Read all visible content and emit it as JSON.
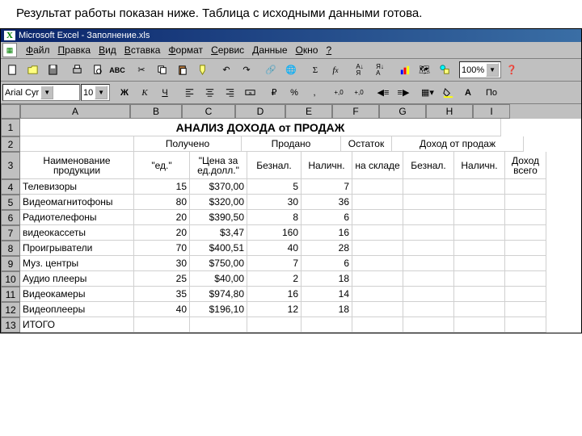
{
  "caption": "Результат работы показан ниже. Таблица с исходными данными готова.",
  "title": "Microsoft Excel - Заполнение.xls",
  "menu": [
    "Файл",
    "Правка",
    "Вид",
    "Вставка",
    "Формат",
    "Сервис",
    "Данные",
    "Окно",
    "?"
  ],
  "zoom": "100%",
  "font": "Arial Cyr",
  "fontsize": "10",
  "fmtBtns": {
    "b": "Ж",
    "i": "К",
    "u": "Ч",
    "pct": "%",
    "comma": ",",
    "inc": "+,0",
    "dec": "+,0"
  },
  "pobtn": "По",
  "cols": [
    "A",
    "B",
    "C",
    "D",
    "E",
    "F",
    "G",
    "H",
    "I"
  ],
  "colW": [
    "cA",
    "cB",
    "cC",
    "cD",
    "cE",
    "cF",
    "cG",
    "cH",
    "cI"
  ],
  "rows": [
    {
      "n": "1",
      "h": "r1",
      "cells": [
        {
          "t": "АНАЛИЗ ДОХОДА от ПРОДАЖ",
          "span": 9,
          "cls": "tac bold",
          "style": "font-size:14px"
        }
      ]
    },
    {
      "n": "2",
      "cells": [
        {
          "t": ""
        },
        {
          "t": "Получено",
          "span": 2,
          "cls": "tac"
        },
        {
          "t": "Продано",
          "span": 2,
          "cls": "tac"
        },
        {
          "t": "Остаток",
          "cls": "tac"
        },
        {
          "t": "Доход от продаж",
          "span": 3,
          "cls": "tac"
        }
      ]
    },
    {
      "n": "3",
      "h": "r3",
      "cells": [
        {
          "t": "Наименование продукции",
          "cls": "tac",
          "wrap": true
        },
        {
          "t": "\"ед.\"",
          "cls": "tac"
        },
        {
          "t": "\"Цена за ед.долл.\"",
          "cls": "tac",
          "wrap": true
        },
        {
          "t": "Безнал.",
          "cls": "tac"
        },
        {
          "t": "Наличн.",
          "cls": "tac"
        },
        {
          "t": "на складе",
          "cls": "tac",
          "wrap": true
        },
        {
          "t": "Безнал.",
          "cls": "tac"
        },
        {
          "t": "Наличн.",
          "cls": "tac"
        },
        {
          "t": "Доход всего",
          "cls": "tac",
          "wrap": true
        }
      ]
    },
    {
      "n": "4",
      "cells": [
        {
          "t": "Телевизоры"
        },
        {
          "t": "15",
          "cls": "tar"
        },
        {
          "t": "$370,00",
          "cls": "tar"
        },
        {
          "t": "5",
          "cls": "tar"
        },
        {
          "t": "7",
          "cls": "tar"
        },
        {
          "t": ""
        },
        {
          "t": ""
        },
        {
          "t": ""
        },
        {
          "t": ""
        }
      ]
    },
    {
      "n": "5",
      "cells": [
        {
          "t": "Видеомагнитофоны"
        },
        {
          "t": "80",
          "cls": "tar"
        },
        {
          "t": "$320,00",
          "cls": "tar"
        },
        {
          "t": "30",
          "cls": "tar"
        },
        {
          "t": "36",
          "cls": "tar"
        },
        {
          "t": ""
        },
        {
          "t": ""
        },
        {
          "t": ""
        },
        {
          "t": ""
        }
      ]
    },
    {
      "n": "6",
      "cells": [
        {
          "t": "Радиотелефоны"
        },
        {
          "t": "20",
          "cls": "tar"
        },
        {
          "t": "$390,50",
          "cls": "tar"
        },
        {
          "t": "8",
          "cls": "tar"
        },
        {
          "t": "6",
          "cls": "tar"
        },
        {
          "t": ""
        },
        {
          "t": ""
        },
        {
          "t": ""
        },
        {
          "t": ""
        }
      ]
    },
    {
      "n": "7",
      "cells": [
        {
          "t": "видеокассеты"
        },
        {
          "t": "20",
          "cls": "tar"
        },
        {
          "t": "$3,47",
          "cls": "tar"
        },
        {
          "t": "160",
          "cls": "tar"
        },
        {
          "t": "16",
          "cls": "tar"
        },
        {
          "t": ""
        },
        {
          "t": ""
        },
        {
          "t": ""
        },
        {
          "t": ""
        }
      ]
    },
    {
      "n": "8",
      "cells": [
        {
          "t": "Проигрыватели"
        },
        {
          "t": "70",
          "cls": "tar"
        },
        {
          "t": "$400,51",
          "cls": "tar"
        },
        {
          "t": "40",
          "cls": "tar"
        },
        {
          "t": "28",
          "cls": "tar"
        },
        {
          "t": ""
        },
        {
          "t": ""
        },
        {
          "t": ""
        },
        {
          "t": ""
        }
      ]
    },
    {
      "n": "9",
      "cells": [
        {
          "t": "Муз. центры"
        },
        {
          "t": "30",
          "cls": "tar"
        },
        {
          "t": "$750,00",
          "cls": "tar"
        },
        {
          "t": "7",
          "cls": "tar"
        },
        {
          "t": "6",
          "cls": "tar"
        },
        {
          "t": ""
        },
        {
          "t": ""
        },
        {
          "t": ""
        },
        {
          "t": ""
        }
      ]
    },
    {
      "n": "10",
      "cells": [
        {
          "t": "Аудио плееры"
        },
        {
          "t": "25",
          "cls": "tar"
        },
        {
          "t": "$40,00",
          "cls": "tar"
        },
        {
          "t": "2",
          "cls": "tar"
        },
        {
          "t": "18",
          "cls": "tar"
        },
        {
          "t": ""
        },
        {
          "t": ""
        },
        {
          "t": ""
        },
        {
          "t": ""
        }
      ]
    },
    {
      "n": "11",
      "cells": [
        {
          "t": "Видеокамеры"
        },
        {
          "t": "35",
          "cls": "tar"
        },
        {
          "t": "$974,80",
          "cls": "tar"
        },
        {
          "t": "16",
          "cls": "tar"
        },
        {
          "t": "14",
          "cls": "tar"
        },
        {
          "t": ""
        },
        {
          "t": ""
        },
        {
          "t": ""
        },
        {
          "t": ""
        }
      ]
    },
    {
      "n": "12",
      "cells": [
        {
          "t": "Видеоплееры"
        },
        {
          "t": "40",
          "cls": "tar"
        },
        {
          "t": "$196,10",
          "cls": "tar"
        },
        {
          "t": "12",
          "cls": "tar"
        },
        {
          "t": "18",
          "cls": "tar"
        },
        {
          "t": ""
        },
        {
          "t": ""
        },
        {
          "t": ""
        },
        {
          "t": ""
        }
      ]
    },
    {
      "n": "13",
      "cells": [
        {
          "t": "ИТОГО"
        },
        {
          "t": ""
        },
        {
          "t": ""
        },
        {
          "t": ""
        },
        {
          "t": ""
        },
        {
          "t": ""
        },
        {
          "t": ""
        },
        {
          "t": ""
        },
        {
          "t": ""
        }
      ]
    }
  ]
}
